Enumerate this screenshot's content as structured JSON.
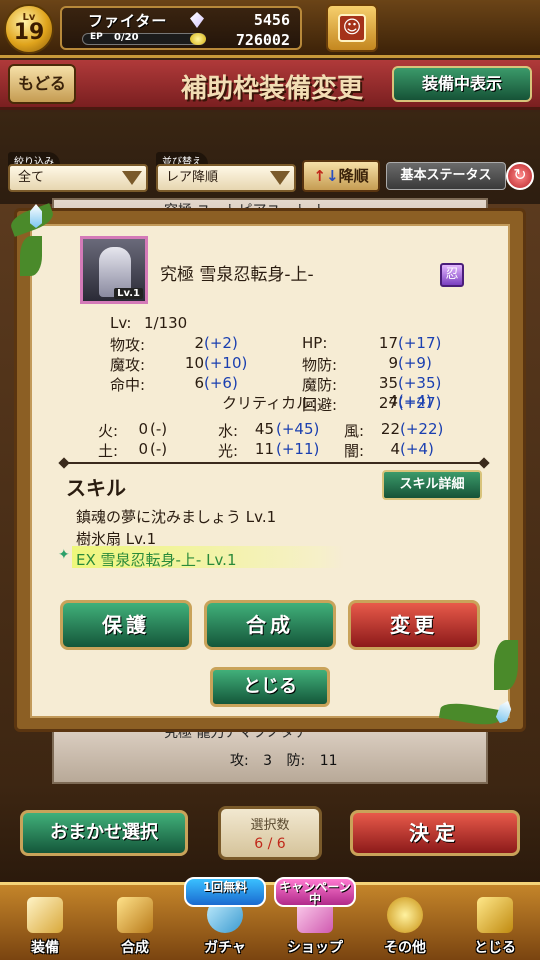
{
  "header": {
    "level_label": "Lv",
    "level": "19",
    "job": "ファイター",
    "ep_label": "EP",
    "ep": "0/20",
    "gems": "5456",
    "coins": "726002"
  },
  "title_bar": {
    "back": "もどる",
    "title": "補助枠装備変更",
    "equipped": "装備中表示"
  },
  "filters": {
    "filter_label": "絞り込み",
    "filter_value": "全て",
    "sort_label": "並び替え",
    "sort_value": "レア降順",
    "order": "降順",
    "order_arrow_up": "↑",
    "order_arrow_down": "↓",
    "status_mode": "基本ステータス"
  },
  "background_list": {
    "top_card_name": "究極 ユートピアユート-ト-",
    "bottom_card_name": "究極 龍刀アマツノタチ",
    "bottom_stats": {
      "atk_label": "攻:",
      "atk": "3",
      "def_label": "防:",
      "def": "11"
    }
  },
  "modal": {
    "thumb_level": "Lv.1",
    "item_name": "究極 雪泉忍転身-上-",
    "class_icon": "忍",
    "level_label": "Lv:",
    "level_value": "1/130",
    "stats": [
      {
        "left_label": "物攻:",
        "left_base": "2",
        "left_plus": "(+2)",
        "right_label": "HP:",
        "right_base": "17",
        "right_plus": "(+17)"
      },
      {
        "left_label": "魔攻:",
        "left_base": "10",
        "left_plus": "(+10)",
        "right_label": "物防:",
        "right_base": "9",
        "right_plus": "(+9)"
      },
      {
        "left_label": "命中:",
        "left_base": "6",
        "left_plus": "(+6)",
        "right_label": "魔防:",
        "right_base": "35",
        "right_plus": "(+35)"
      },
      {
        "left_label": "",
        "left_base": "",
        "left_plus": "",
        "right_label": "回避:",
        "right_base": "27",
        "right_plus": "(+27)"
      }
    ],
    "critical": {
      "label": "クリティカル:",
      "base": "4",
      "plus": "(+4)"
    },
    "elements": [
      {
        "a_label": "火:",
        "a_base": "0",
        "a_plus": "(-)",
        "b_label": "水:",
        "b_base": "45",
        "b_plus": "(+45)",
        "c_label": "風:",
        "c_base": "22",
        "c_plus": "(+22)"
      },
      {
        "a_label": "土:",
        "a_base": "0",
        "a_plus": "(-)",
        "b_label": "光:",
        "b_base": "11",
        "b_plus": "(+11)",
        "c_label": "闇:",
        "c_base": "4",
        "c_plus": "(+4)"
      }
    ],
    "skill_title": "スキル",
    "skill_detail": "スキル詳細",
    "skills": [
      "鎮魂の夢に沈みましょう Lv.1",
      "樹氷扇 Lv.1"
    ],
    "ex_skill": "EX 雪泉忍転身-上- Lv.1",
    "buttons": {
      "protect": "保護",
      "synth": "合成",
      "change": "変更",
      "close": "とじる"
    }
  },
  "bottom": {
    "auto_select": "おまかせ選択",
    "count_label": "選択数",
    "count_value": "6 / 6",
    "confirm": "決定"
  },
  "nav": [
    {
      "label": "装備",
      "icon": "sword-icon"
    },
    {
      "label": "合成",
      "icon": "hammer-icon"
    },
    {
      "label": "ガチャ",
      "icon": "gacha-icon",
      "badge": "1回無料"
    },
    {
      "label": "ショップ",
      "icon": "shop-icon",
      "badge": "キャンペーン中"
    },
    {
      "label": "その他",
      "icon": "gear-icon"
    },
    {
      "label": "とじる",
      "icon": "close-icon"
    }
  ],
  "colors": {
    "accent_green": "#14573a",
    "accent_red": "#8c1a1a",
    "plus_blue": "#1a3fb0",
    "panel_cream": "#f6ecd4"
  }
}
